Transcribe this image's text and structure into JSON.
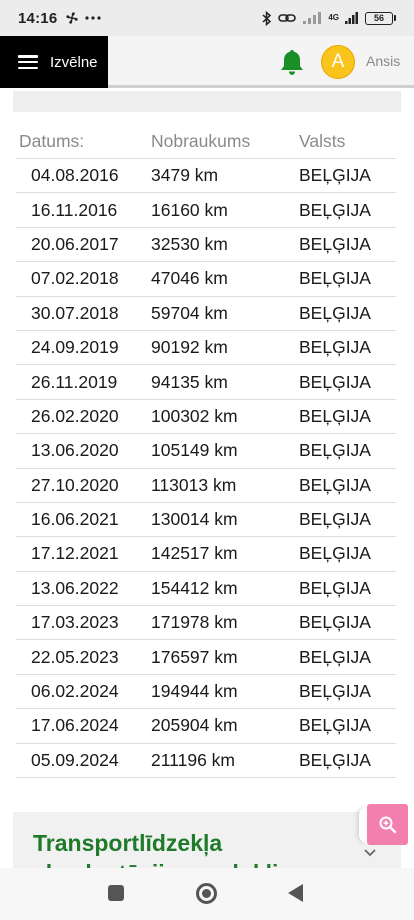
{
  "status_bar": {
    "time": "14:16",
    "left_icons": [
      "fan-icon",
      "more-dots-icon"
    ],
    "network": "4G",
    "battery": "56"
  },
  "header": {
    "menu_label": "Izvēlne",
    "avatar_letter": "A",
    "user_name": "Ansis",
    "accent_color": "#1a8f27",
    "avatar_color": "#f9c41b"
  },
  "table": {
    "headers": [
      "Datums:",
      "Nobraukums",
      "Valsts"
    ],
    "rows": [
      {
        "date": "04.08.2016",
        "mileage": "3479 km",
        "country": "BEĻĢIJA"
      },
      {
        "date": "16.11.2016",
        "mileage": "16160 km",
        "country": "BEĻĢIJA"
      },
      {
        "date": "20.06.2017",
        "mileage": "32530 km",
        "country": "BEĻĢIJA"
      },
      {
        "date": "07.02.2018",
        "mileage": "47046 km",
        "country": "BEĻĢIJA"
      },
      {
        "date": "30.07.2018",
        "mileage": "59704 km",
        "country": "BEĻĢIJA"
      },
      {
        "date": "24.09.2019",
        "mileage": "90192 km",
        "country": "BEĻĢIJA"
      },
      {
        "date": "26.11.2019",
        "mileage": "94135 km",
        "country": "BEĻĢIJA"
      },
      {
        "date": "26.02.2020",
        "mileage": "100302 km",
        "country": "BEĻĢIJA"
      },
      {
        "date": "13.06.2020",
        "mileage": "105149 km",
        "country": "BEĻĢIJA"
      },
      {
        "date": "27.10.2020",
        "mileage": "113013 km",
        "country": "BEĻĢIJA"
      },
      {
        "date": "16.06.2021",
        "mileage": "130014 km",
        "country": "BEĻĢIJA"
      },
      {
        "date": "17.12.2021",
        "mileage": "142517 km",
        "country": "BEĻĢIJA"
      },
      {
        "date": "13.06.2022",
        "mileage": "154412 km",
        "country": "BEĻĢIJA"
      },
      {
        "date": "17.03.2023",
        "mileage": "171978 km",
        "country": "BEĻĢIJA"
      },
      {
        "date": "22.05.2023",
        "mileage": "176597 km",
        "country": "BEĻĢIJA"
      },
      {
        "date": "06.02.2024",
        "mileage": "194944 km",
        "country": "BEĻĢIJA"
      },
      {
        "date": "17.06.2024",
        "mileage": "205904 km",
        "country": "BEĻĢIJA"
      },
      {
        "date": "05.09.2024",
        "mileage": "211196 km",
        "country": "BEĻĢIJA"
      }
    ]
  },
  "accordion": {
    "title": "Transportlīdzekļa ekspluatācijas nodoklis",
    "title_color": "#1f7a2a"
  },
  "fab": {
    "icon": "zoom-in-icon",
    "color": "#f27fae"
  }
}
